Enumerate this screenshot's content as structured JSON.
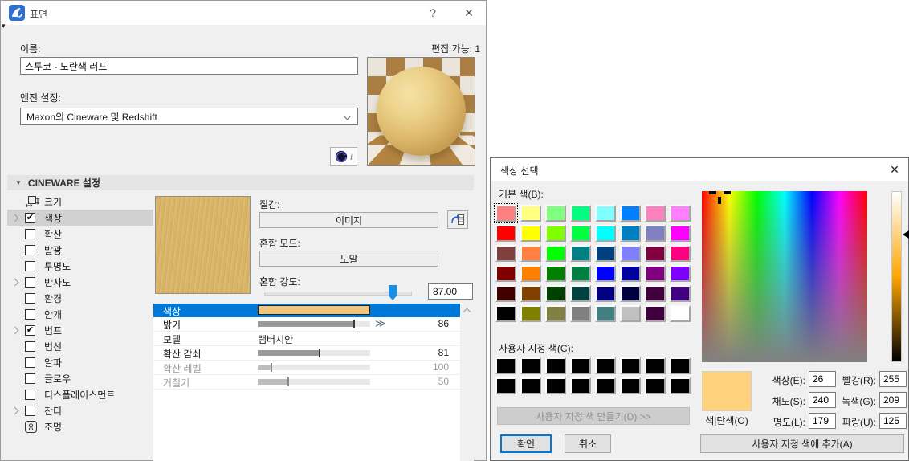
{
  "glyphs": {
    "help": "?",
    "close": "✕",
    "check": "✔",
    "section_collapse": "▼",
    "flyout": "▾",
    "double_chevron": "≫",
    "info": "i"
  },
  "colors": {
    "selection_blue": "#0078d7",
    "tree_selected_gray": "#d1d1d1",
    "texture_tan": "#d9b467",
    "property_swatch": "#f2c57e",
    "slider_thumb_blue": "#1e8fe0",
    "picker_preview": "#ffd17d",
    "hue_mid": "#ffa600"
  },
  "surface_dialog": {
    "title": "표면",
    "name_label": "이름:",
    "editable_label": "편집 가능:",
    "editable_count": "1",
    "name_value": "스투코 - 노란색 러프",
    "engine_label": "엔진 설정:",
    "engine_value": "Maxon의 Cineware 및 Redshift",
    "cineware_header": "CINEWARE 설정",
    "tree": [
      {
        "label": "크기",
        "icon": "size"
      },
      {
        "label": "색상",
        "checkbox": true,
        "checked": true,
        "expand": true,
        "selected": true
      },
      {
        "label": "확산",
        "checkbox": true,
        "checked": false
      },
      {
        "label": "발광",
        "checkbox": true,
        "checked": false
      },
      {
        "label": "투명도",
        "checkbox": true,
        "checked": false
      },
      {
        "label": "반사도",
        "checkbox": true,
        "checked": false,
        "expand": true
      },
      {
        "label": "환경",
        "checkbox": true,
        "checked": false
      },
      {
        "label": "안개",
        "checkbox": true,
        "checked": false
      },
      {
        "label": "범프",
        "checkbox": true,
        "checked": true,
        "expand": true
      },
      {
        "label": "법선",
        "checkbox": true,
        "checked": false
      },
      {
        "label": "알파",
        "checkbox": true,
        "checked": false
      },
      {
        "label": "글로우",
        "checkbox": true,
        "checked": false
      },
      {
        "label": "디스플레이스먼트",
        "checkbox": true,
        "checked": false
      },
      {
        "label": "잔디",
        "checkbox": true,
        "checked": false,
        "expand": true
      },
      {
        "label": "조명",
        "icon": "lamp"
      }
    ],
    "texture_label": "질감:",
    "texture_button": "이미지",
    "blend_mode_label": "혼합 모드:",
    "blend_mode_button": "노말",
    "blend_strength_label": "혼합 강도:",
    "blend_strength_value": "87.00",
    "blend_strength_pct": 87,
    "properties": [
      {
        "name": "색상",
        "type": "color",
        "selected": true
      },
      {
        "name": "밝기",
        "type": "slider",
        "value": "86",
        "fill_pct": 86,
        "chevron": true
      },
      {
        "name": "모델",
        "type": "text",
        "value": "램버시안"
      },
      {
        "name": "확산 감쇠",
        "type": "slider",
        "value": "81",
        "fill_pct": 55
      },
      {
        "name": "확산 레벨",
        "type": "slider",
        "value": "100",
        "fill_pct": 12,
        "disabled": true
      },
      {
        "name": "거칠기",
        "type": "slider",
        "value": "50",
        "fill_pct": 27,
        "disabled": true
      }
    ]
  },
  "color_dialog": {
    "title": "색상 선택",
    "basic_label": "기본 색(B):",
    "basic_colors": [
      "#FF8080",
      "#FFFF80",
      "#80FF80",
      "#00FF80",
      "#80FFFF",
      "#0080FF",
      "#FF80C0",
      "#FF80FF",
      "#FF0000",
      "#FFFF00",
      "#80FF00",
      "#00FF40",
      "#00FFFF",
      "#0080C0",
      "#8080C0",
      "#FF00FF",
      "#804040",
      "#FF8040",
      "#00FF00",
      "#008080",
      "#004080",
      "#8080FF",
      "#800040",
      "#FF0080",
      "#800000",
      "#FF8000",
      "#008000",
      "#008040",
      "#0000FF",
      "#0000A0",
      "#800080",
      "#8000FF",
      "#400000",
      "#804000",
      "#004000",
      "#004040",
      "#000080",
      "#000040",
      "#400040",
      "#400080",
      "#000000",
      "#808000",
      "#808040",
      "#808080",
      "#408080",
      "#C0C0C0",
      "#400040",
      "#FFFFFF"
    ],
    "selected_basic_index": 0,
    "custom_label": "사용자 지정 색(C):",
    "custom_colors": [
      "#000000",
      "#000000",
      "#000000",
      "#000000",
      "#000000",
      "#000000",
      "#000000",
      "#000000",
      "#000000",
      "#000000",
      "#000000",
      "#000000",
      "#000000",
      "#000000",
      "#000000",
      "#000000"
    ],
    "define_button": "사용자 지정 색 만들기(D) >>",
    "ok_button": "확인",
    "cancel_button": "취소",
    "add_button": "사용자 지정 색에 추가(A)",
    "solid_label": "색|단색(O)",
    "hsl_fields": [
      {
        "label": "색상(E):",
        "value": "26"
      },
      {
        "label": "채도(S):",
        "value": "240"
      },
      {
        "label": "명도(L):",
        "value": "179"
      }
    ],
    "rgb_fields": [
      {
        "label": "빨강(R):",
        "value": "255"
      },
      {
        "label": "녹색(G):",
        "value": "209"
      },
      {
        "label": "파랑(U):",
        "value": "125"
      }
    ]
  }
}
